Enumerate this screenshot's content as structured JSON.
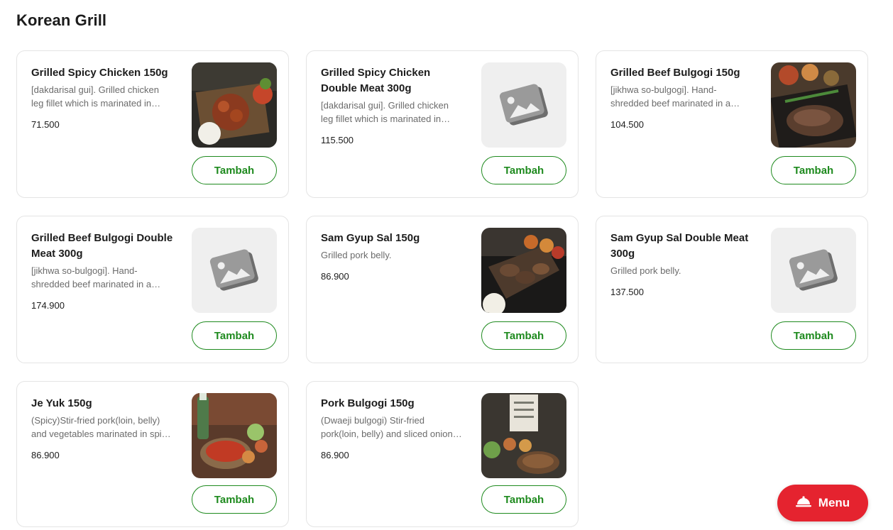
{
  "section": {
    "title": "Korean Grill"
  },
  "add_label": "Tambah",
  "fab": {
    "label": "Menu",
    "icon": "cloche-icon",
    "color": "#e5232f"
  },
  "accent_color": "#1e8a1e",
  "items": [
    {
      "name": "Grilled Spicy Chicken 150g",
      "description": "[dakdarisal gui]. Grilled chicken leg fillet which is marinated in Korean spicy sauce.",
      "price": "71.500",
      "image": "photo"
    },
    {
      "name": "Grilled Spicy Chicken Double Meat 300g",
      "description": "[dakdarisal gui]. Grilled chicken leg fillet which is marinated in Korean spicy sauce.",
      "price": "115.500",
      "image": "placeholder"
    },
    {
      "name": "Grilled Beef Bulgogi 150g",
      "description": "[jikhwa so-bulgogi]. Hand-shredded beef marinated in a sweet soy sauce.",
      "price": "104.500",
      "image": "photo"
    },
    {
      "name": "Grilled Beef Bulgogi Double Meat 300g",
      "description": "[jikhwa so-bulgogi]. Hand-shredded beef marinated in a sweet soy sauce.",
      "price": "174.900",
      "image": "placeholder"
    },
    {
      "name": "Sam Gyup Sal 150g",
      "description": "Grilled pork belly.",
      "price": "86.900",
      "image": "photo"
    },
    {
      "name": "Sam Gyup Sal Double Meat 300g",
      "description": "Grilled pork belly.",
      "price": "137.500",
      "image": "placeholder"
    },
    {
      "name": "Je Yuk 150g",
      "description": "(Spicy)Stir-fried pork(loin, belly) and vegetables marinated in spicy sauce.",
      "price": "86.900",
      "image": "photo"
    },
    {
      "name": "Pork Bulgogi 150g",
      "description": "(Dwaeji bulgogi) Stir-fried pork(loin, belly) and sliced onion in sweet soy sauce.",
      "price": "86.900",
      "image": "photo"
    }
  ]
}
